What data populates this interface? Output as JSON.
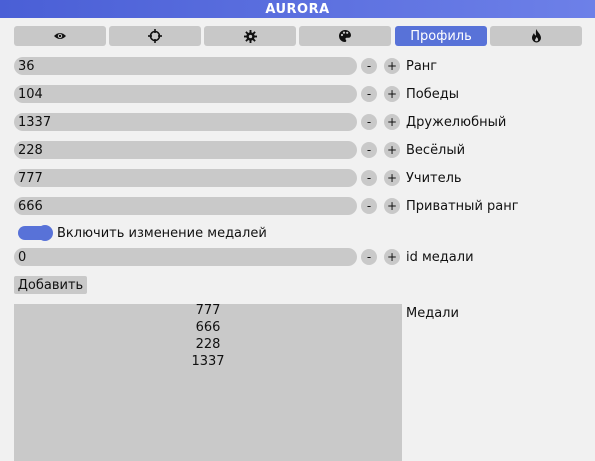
{
  "app": {
    "title": "AURORA"
  },
  "tabs": [
    {
      "icon": "eye-icon",
      "label": ""
    },
    {
      "icon": "crosshair-icon",
      "label": ""
    },
    {
      "icon": "gear-icon",
      "label": ""
    },
    {
      "icon": "palette-icon",
      "label": ""
    },
    {
      "icon": "",
      "label": "Профиль",
      "active": true
    },
    {
      "icon": "flame-icon",
      "label": ""
    }
  ],
  "fields": [
    {
      "value": "36",
      "label": "Ранг"
    },
    {
      "value": "104",
      "label": "Победы"
    },
    {
      "value": "1337",
      "label": "Дружелюбный"
    },
    {
      "value": "228",
      "label": "Весёлый"
    },
    {
      "value": "777",
      "label": "Учитель"
    },
    {
      "value": "666",
      "label": "Приватный ранг"
    }
  ],
  "medal_toggle": {
    "label": "Включить изменение медалей",
    "on": true
  },
  "medal_id": {
    "value": "0",
    "label": "id медали"
  },
  "buttons": {
    "minus": "-",
    "plus": "+",
    "add": "Добавить"
  },
  "medals": {
    "label": "Медали",
    "items": [
      "777",
      "666",
      "228",
      "1337"
    ]
  },
  "colors": {
    "accent": "#5872d8",
    "control_bg": "#c9c9c9",
    "panel_bg": "#f1f1f1"
  }
}
